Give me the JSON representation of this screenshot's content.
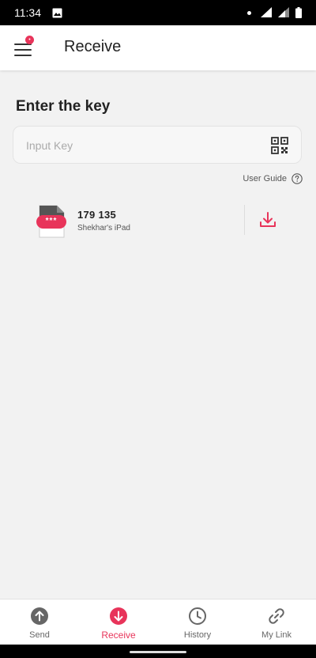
{
  "status_bar": {
    "time": "11:34"
  },
  "app_bar": {
    "title": "Receive",
    "menu_badge": "•"
  },
  "receive": {
    "heading": "Enter the key",
    "key_input": {
      "placeholder": "Input Key",
      "value": ""
    },
    "user_guide_label": "User Guide"
  },
  "received_items": [
    {
      "key": "179 135",
      "device": "Shekhar's iPad",
      "file_badge": "***"
    }
  ],
  "bottom_nav": [
    {
      "label": "Send"
    },
    {
      "label": "Receive",
      "active": true
    },
    {
      "label": "History"
    },
    {
      "label": "My Link"
    }
  ],
  "colors": {
    "accent": "#e8345a",
    "icon_gray": "#666666",
    "background": "#f2f2f2"
  }
}
